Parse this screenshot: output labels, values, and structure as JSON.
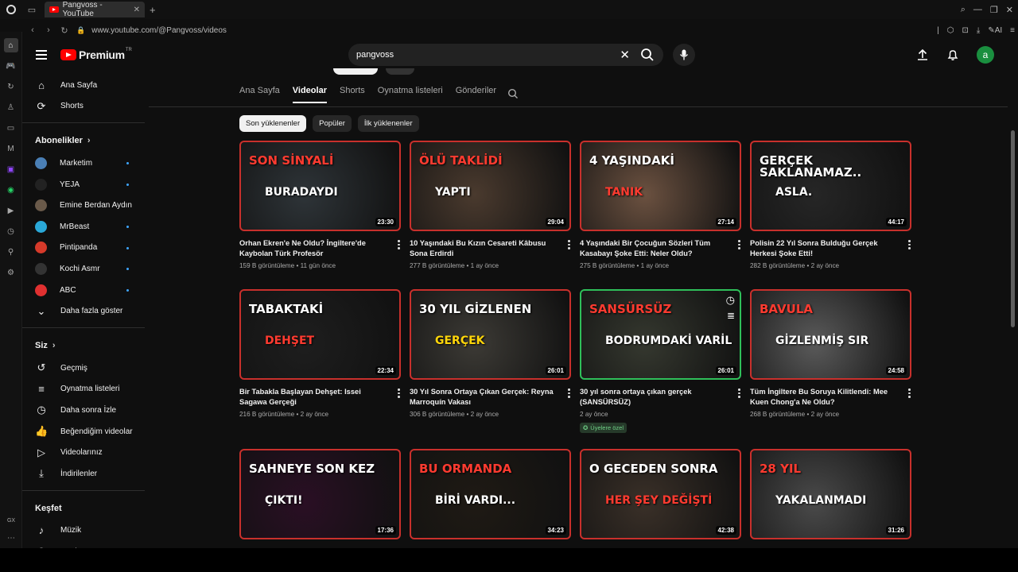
{
  "browser": {
    "tab_title": "Pangvoss - YouTube",
    "url": "www.youtube.com/@Pangvoss/videos",
    "gx_label": "GX"
  },
  "header": {
    "logo_text": "Premium",
    "logo_sup": "TR",
    "search_value": "pangvoss",
    "avatar_letter": "a"
  },
  "sidebar": {
    "main": [
      {
        "label": "Ana Sayfa",
        "icon": "home-icon",
        "glyph": "⌂"
      },
      {
        "label": "Shorts",
        "icon": "shorts-icon",
        "glyph": "⟳"
      }
    ],
    "subs_heading": "Abonelikler",
    "subscriptions": [
      {
        "label": "Marketim",
        "color": "#4a7fb5",
        "dot": true
      },
      {
        "label": "YEJA",
        "color": "#222222",
        "dot": true
      },
      {
        "label": "Emine Berdan Aydın",
        "color": "#6a5a4a",
        "dot": false
      },
      {
        "label": "MrBeast",
        "color": "#2aa8d8",
        "dot": true
      },
      {
        "label": "Pintipanda",
        "color": "#d63a2a",
        "dot": true
      },
      {
        "label": "Kochi Asmr",
        "color": "#333333",
        "dot": true
      },
      {
        "label": "ABC",
        "color": "#e03030",
        "dot": true
      }
    ],
    "show_more": "Daha fazla göster",
    "you_heading": "Siz",
    "you_items": [
      {
        "label": "Geçmiş",
        "icon": "history-icon",
        "glyph": "↺"
      },
      {
        "label": "Oynatma listeleri",
        "icon": "playlists-icon",
        "glyph": "≡"
      },
      {
        "label": "Daha sonra İzle",
        "icon": "watch-later-icon",
        "glyph": "◷"
      },
      {
        "label": "Beğendiğim videolar",
        "icon": "like-icon",
        "glyph": "👍"
      },
      {
        "label": "Videolarınız",
        "icon": "your-videos-icon",
        "glyph": "▷"
      },
      {
        "label": "İndirilenler",
        "icon": "downloads-icon",
        "glyph": "⤓"
      }
    ],
    "explore_heading": "Keşfet",
    "explore_items": [
      {
        "label": "Müzik",
        "icon": "music-icon",
        "glyph": "♪"
      },
      {
        "label": "Canlı",
        "icon": "live-icon",
        "glyph": "◉"
      }
    ]
  },
  "channel_tabs": [
    "Ana Sayfa",
    "Videolar",
    "Shorts",
    "Oynatma listeleri",
    "Gönderiler"
  ],
  "active_tab": "Videolar",
  "chips": [
    "Son yüklenenler",
    "Popüler",
    "İlk yüklenenler"
  ],
  "videos": [
    {
      "title": "Orhan Ekren'e Ne Oldu? İngiltere'de Kaybolan Türk Profesör",
      "views": "159 B görüntüleme",
      "age": "11 gün önce",
      "duration": "23:30",
      "thumb_text1": "SON SİNYALİ",
      "thumb_text2": "BURADAYDI",
      "bg": "#2e3438",
      "border": "#c8302c",
      "c1": "#ff3b30",
      "c2": "#ffffff"
    },
    {
      "title": "10 Yaşındaki Bu Kızın Cesareti Kâbusu Sona Erdirdi",
      "views": "277 B görüntüleme",
      "age": "1 ay önce",
      "duration": "29:04",
      "thumb_text1": "ÖLÜ TAKLİDİ",
      "thumb_text2": "YAPTI",
      "bg": "#4a3a2e",
      "border": "#c8302c",
      "c1": "#ff3b30",
      "c2": "#ffffff"
    },
    {
      "title": "4 Yaşındaki Bir Çocuğun Sözleri Tüm Kasabayı Şoke Etti: Neler Oldu?",
      "views": "275 B görüntüleme",
      "age": "1 ay önce",
      "duration": "27:14",
      "thumb_text1": "4 YAŞINDAKİ",
      "thumb_text2": "TANIK",
      "bg": "#6b5140",
      "border": "#c8302c",
      "c1": "#ffffff",
      "c2": "#ff3b30"
    },
    {
      "title": "Polisin 22 Yıl Sonra Bulduğu Gerçek Herkesi Şoke Etti!",
      "views": "282 B görüntüleme",
      "age": "2 ay önce",
      "duration": "44:17",
      "thumb_text1": "GERÇEK SAKLANAMAZ..",
      "thumb_text2": "ASLA.",
      "bg": "#262626",
      "border": "#c8302c",
      "c1": "#ffffff",
      "c2": "#ffffff"
    },
    {
      "title": "Bir Tabakla Başlayan Dehşet: Issei Sagawa Gerçeği",
      "views": "216 B görüntüleme",
      "age": "2 ay önce",
      "duration": "22:34",
      "thumb_text1": "TABAKTAKİ",
      "thumb_text2": "DEHŞET",
      "bg": "#1e1e1e",
      "border": "#c8302c",
      "c1": "#ffffff",
      "c2": "#ff3b30"
    },
    {
      "title": "30 Yıl Sonra Ortaya Çıkan Gerçek: Reyna Marroquín Vakası",
      "views": "306 B görüntüleme",
      "age": "2 ay önce",
      "duration": "26:01",
      "thumb_text1": "30 YIL GİZLENEN",
      "thumb_text2": "GERÇEK",
      "bg": "#3c3a35",
      "border": "#c8302c",
      "c1": "#ffffff",
      "c2": "#ffd60a"
    },
    {
      "title": "30 yıl sonra ortaya çıkan gerçek (SANSÜRSÜZ)",
      "views": "",
      "age": "2 ay önce",
      "duration": "26:01",
      "thumb_text1": "SANSÜRSÜZ",
      "thumb_text2": "BODRUMDAKİ VARİL",
      "bg": "#35382f",
      "border": "#2fbf5a",
      "c1": "#ff3b30",
      "c2": "#ffffff",
      "badge": "Üyelere özel"
    },
    {
      "title": "Tüm İngiltere Bu Soruya Kilitlendi: Mee Kuen Chong'a Ne Oldu?",
      "views": "268 B görüntüleme",
      "age": "2 ay önce",
      "duration": "24:58",
      "thumb_text1": "BAVULA",
      "thumb_text2": "GİZLENMİŞ SIR",
      "bg": "#5a5a5a",
      "border": "#c8302c",
      "c1": "#ff3b30",
      "c2": "#ffffff"
    },
    {
      "title": "",
      "views": "",
      "age": "",
      "duration": "17:36",
      "thumb_text1": "SAHNEYE SON KEZ",
      "thumb_text2": "ÇIKTI!",
      "bg": "#2a0f24",
      "border": "#c8302c",
      "c1": "#ffffff",
      "c2": "#ffffff"
    },
    {
      "title": "",
      "views": "",
      "age": "",
      "duration": "34:23",
      "thumb_text1": "BU ORMANDA",
      "thumb_text2": "BİRİ VARDI...",
      "bg": "#1f1a14",
      "border": "#c8302c",
      "c1": "#ff3b30",
      "c2": "#ffffff"
    },
    {
      "title": "",
      "views": "",
      "age": "",
      "duration": "42:38",
      "thumb_text1": "O GECEDEN SONRA",
      "thumb_text2": "HER ŞEY DEĞİŞTİ",
      "bg": "#3a3028",
      "border": "#c8302c",
      "c1": "#ffffff",
      "c2": "#ff3b30"
    },
    {
      "title": "",
      "views": "",
      "age": "",
      "duration": "31:26",
      "thumb_text1": "28 YIL",
      "thumb_text2": "YAKALANMADI",
      "bg": "#4a4a4a",
      "border": "#c8302c",
      "c1": "#ff3b30",
      "c2": "#ffffff"
    }
  ]
}
